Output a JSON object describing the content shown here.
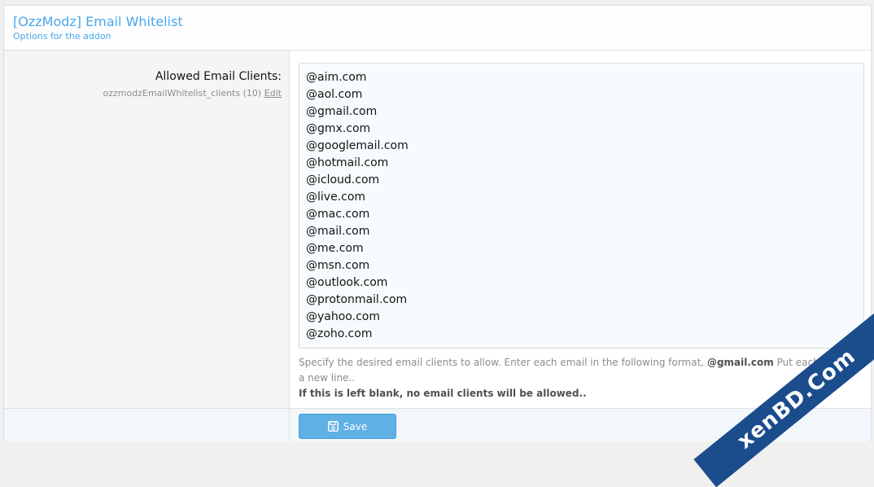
{
  "header": {
    "title": "[OzzModz] Email Whitelist",
    "description": "Options for the addon"
  },
  "option": {
    "label": "Allowed Email Clients:",
    "hint_id": "ozzmodzEmailWhitelist_clients (10)",
    "edit_link": "Edit",
    "lines": [
      "@aim.com",
      "@aol.com",
      "@gmail.com",
      "@gmx.com",
      "@googlemail.com",
      "@hotmail.com",
      "@icloud.com",
      "@live.com",
      "@mac.com",
      "@mail.com",
      "@me.com",
      "@msn.com",
      "@outlook.com",
      "@protonmail.com",
      "@yahoo.com",
      "@zoho.com"
    ],
    "explain_prefix": "Specify the desired email clients to allow. Enter each email in the following format,",
    "explain_bold": "@gmail.com",
    "explain_suffix": "Put each client on a new line..",
    "explain_warning": "If this is left blank, no email clients will be allowed.."
  },
  "actions": {
    "save_label": "Save",
    "save_icon": "save-icon"
  },
  "watermark": "xenBD.Com",
  "colors": {
    "accent": "#47a7eb",
    "button": "#5fb0e5",
    "watermark_bg": "#1b4c8c"
  }
}
